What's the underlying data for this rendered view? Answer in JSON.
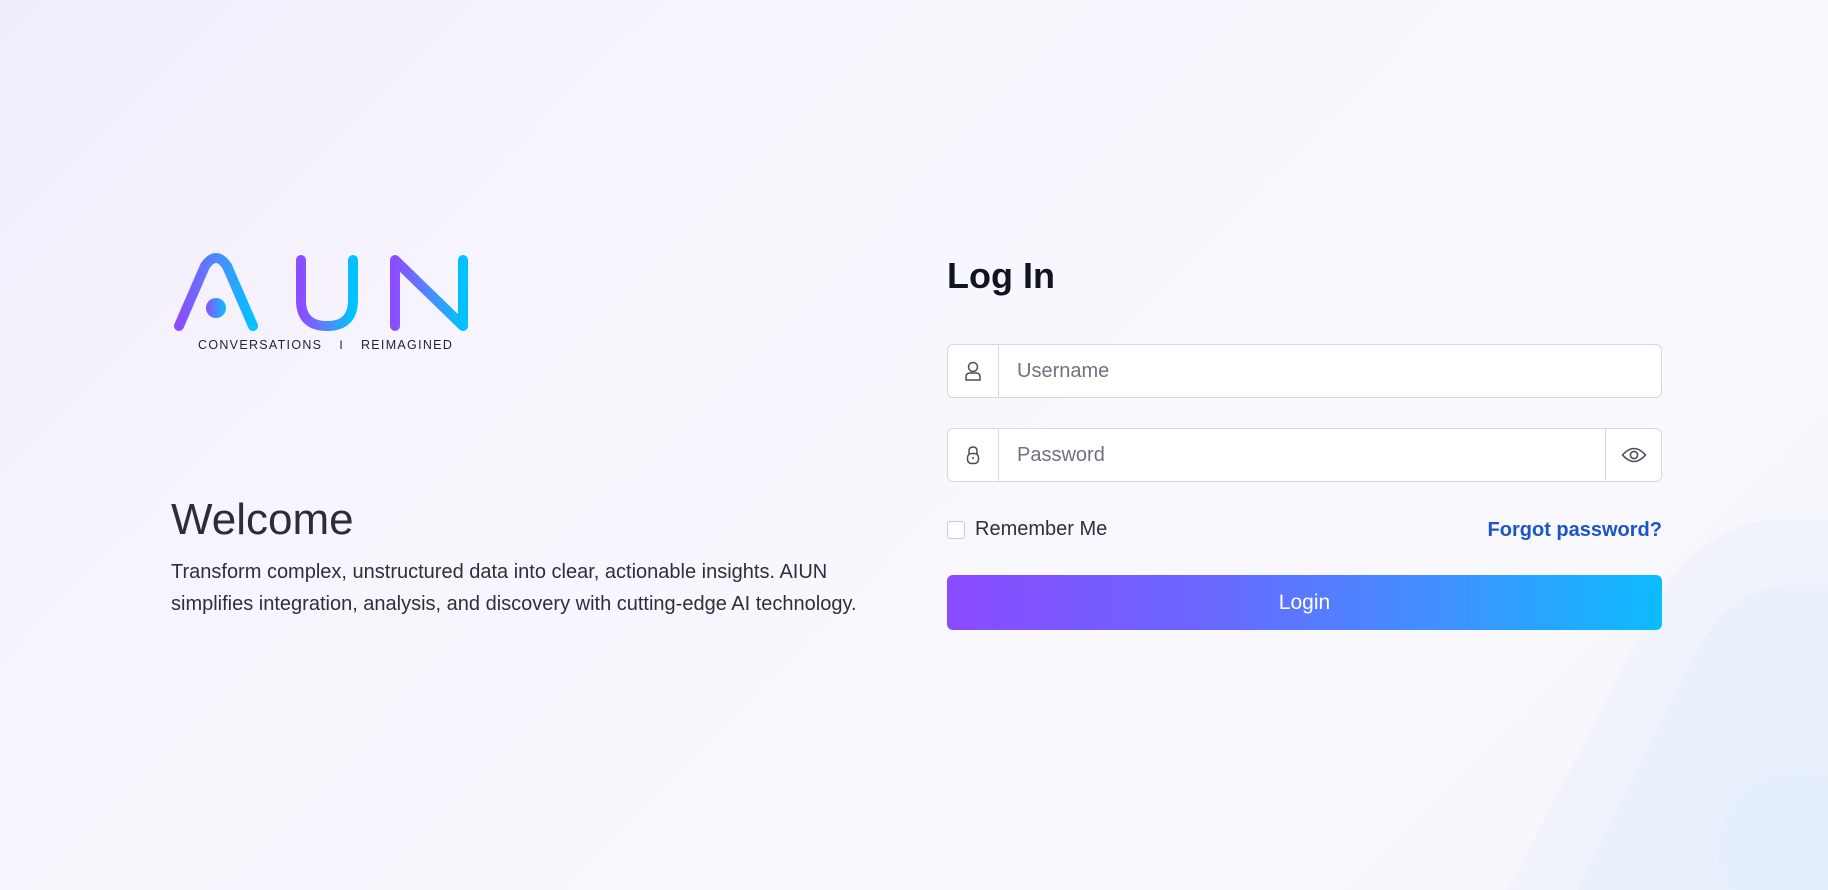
{
  "brand": {
    "logo_text": "AIUN",
    "tagline_left": "CONVERSATIONS",
    "tagline_sep": "I",
    "tagline_right": "REIMAGINED",
    "gradient_start": "#8b4dff",
    "gradient_end": "#00c3ff"
  },
  "intro": {
    "heading": "Welcome",
    "description": "Transform complex, unstructured data into clear, actionable insights. AIUN simplifies integration, analysis, and discovery with cutting-edge AI technology."
  },
  "login": {
    "title": "Log In",
    "username": {
      "placeholder": "Username",
      "value": "",
      "icon": "user-icon"
    },
    "password": {
      "placeholder": "Password",
      "value": "",
      "icon": "lock-icon",
      "toggle_icon": "eye-icon"
    },
    "remember_label": "Remember Me",
    "remember_checked": false,
    "forgot_label": "Forgot password?",
    "submit_label": "Login",
    "link_color": "#1a56c4"
  }
}
